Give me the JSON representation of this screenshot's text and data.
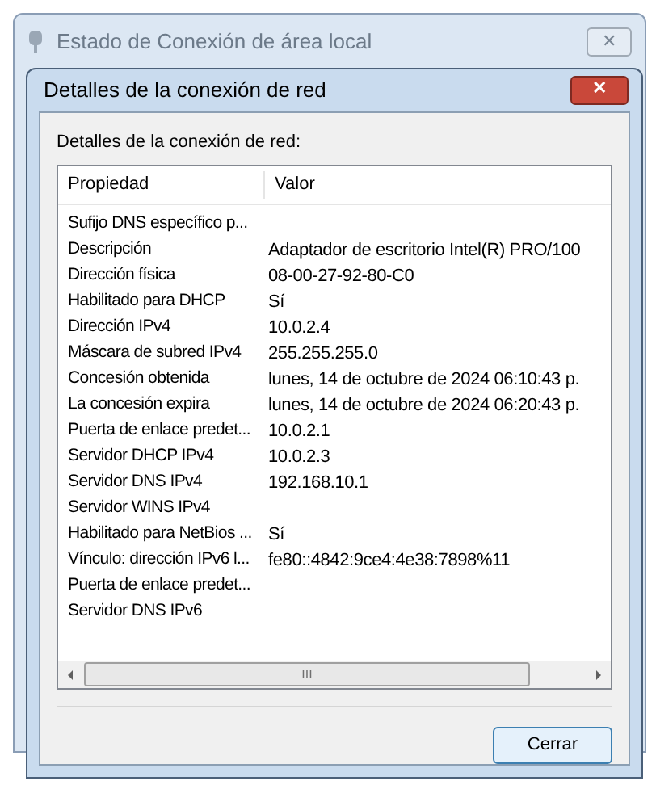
{
  "back_window": {
    "title": "Estado de Conexión de área local",
    "close": "✕"
  },
  "dialog": {
    "title": "Detalles de la conexión de red",
    "close": "✕",
    "label": "Detalles de la conexión de red:",
    "columns": [
      "Propiedad",
      "Valor"
    ],
    "rows": [
      [
        "Sufijo DNS específico p...",
        ""
      ],
      [
        "Descripción",
        "Adaptador de escritorio Intel(R) PRO/100"
      ],
      [
        "Dirección física",
        "08-00-27-92-80-C0"
      ],
      [
        "Habilitado para DHCP",
        "Sí"
      ],
      [
        "Dirección IPv4",
        "10.0.2.4"
      ],
      [
        "Máscara de subred IPv4",
        "255.255.255.0"
      ],
      [
        "Concesión obtenida",
        "lunes, 14 de octubre de 2024 06:10:43 p."
      ],
      [
        "La concesión expira",
        "lunes, 14 de octubre de 2024 06:20:43 p."
      ],
      [
        "Puerta de enlace predet...",
        "10.0.2.1"
      ],
      [
        "Servidor DHCP IPv4",
        "10.0.2.3"
      ],
      [
        "Servidor DNS IPv4",
        "192.168.10.1"
      ],
      [
        "Servidor WINS IPv4",
        ""
      ],
      [
        "Habilitado para NetBios ...",
        "Sí"
      ],
      [
        "Vínculo: dirección IPv6 l...",
        "fe80::4842:9ce4:4e38:7898%11"
      ],
      [
        "Puerta de enlace predet...",
        ""
      ],
      [
        "Servidor DNS IPv6",
        ""
      ]
    ],
    "scroll_grip": "III",
    "button": "Cerrar"
  }
}
